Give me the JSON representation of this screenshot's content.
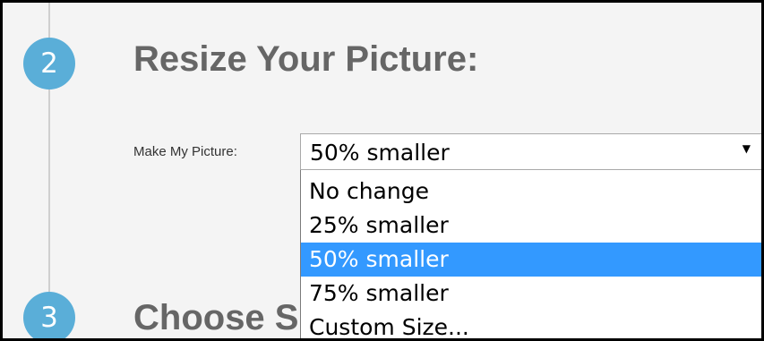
{
  "colors": {
    "accent": "#5aaed8",
    "selected_bg": "#3399ff",
    "selected_text": "#ffffff"
  },
  "steps": [
    {
      "number": "2",
      "title": "Resize Your Picture:"
    },
    {
      "number": "3",
      "title": "Choose S"
    }
  ],
  "resize": {
    "label": "Make My Picture:",
    "selected_value": "50% smaller",
    "arrow_icon": "dropdown-arrow-icon",
    "arrow_glyph": "▼",
    "options": [
      {
        "label": "No change",
        "selected": false
      },
      {
        "label": "25% smaller",
        "selected": false
      },
      {
        "label": "50% smaller",
        "selected": true
      },
      {
        "label": "75% smaller",
        "selected": false
      },
      {
        "label": "Custom Size...",
        "selected": false
      }
    ]
  }
}
